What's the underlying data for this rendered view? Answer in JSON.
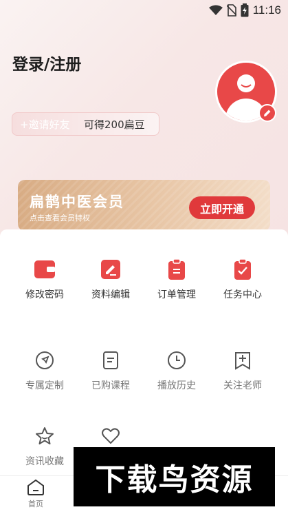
{
  "status_bar": {
    "time": "11:16",
    "icons": [
      "wifi-icon",
      "no-sim-icon",
      "battery-charging-icon"
    ]
  },
  "profile": {
    "login_label": "登录/注册",
    "invite_tag": "+邀请好友",
    "invite_reward": "可得200扁豆",
    "avatar_icon": "default-avatar-icon",
    "edit_icon": "pencil-icon"
  },
  "vip_banner": {
    "title": "扁鹊中医会员",
    "subtitle": "点击查看会员特权",
    "button": "立即开通"
  },
  "menu_primary": [
    {
      "label": "修改密码",
      "icon": "wallet-icon"
    },
    {
      "label": "资料编辑",
      "icon": "edit-doc-icon"
    },
    {
      "label": "订单管理",
      "icon": "clipboard-icon"
    },
    {
      "label": "任务中心",
      "icon": "task-check-icon"
    }
  ],
  "menu_secondary": [
    {
      "label": "专属定制",
      "icon": "compass-icon"
    },
    {
      "label": "已购课程",
      "icon": "document-icon"
    },
    {
      "label": "播放历史",
      "icon": "clock-icon"
    },
    {
      "label": "关注老师",
      "icon": "bookmark-plus-icon"
    }
  ],
  "menu_tertiary": [
    {
      "label": "资讯收藏",
      "icon": "star-icon"
    },
    {
      "label": "",
      "icon": "heart-icon"
    }
  ],
  "tab_bar": {
    "home_label": "首页"
  },
  "watermark": "下载鸟资源",
  "colors": {
    "accent": "#e84848",
    "vip_gold": "#dcb08a",
    "vip_button": "#e0393b"
  }
}
